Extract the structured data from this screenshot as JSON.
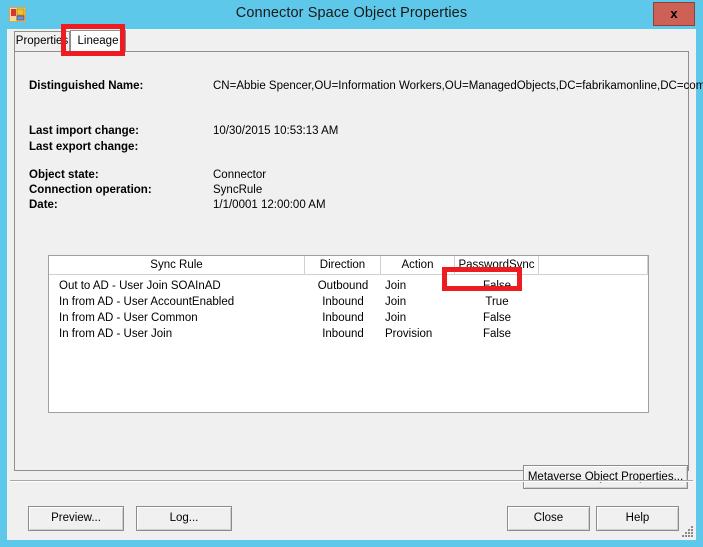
{
  "window": {
    "title": "Connector Space Object Properties",
    "app_icon": "properties-window-icon",
    "close_label": "x",
    "titlebar_color": "#5ec8ea",
    "close_button_color": "#cd6155"
  },
  "tabs": [
    {
      "label": "Properties",
      "selected": false
    },
    {
      "label": "Lineage",
      "selected": true
    }
  ],
  "details": {
    "distinguished_name_label": "Distinguished Name:",
    "distinguished_name_value": "CN=Abbie Spencer,OU=Information Workers,OU=ManagedObjects,DC=fabrikamonline,DC=com",
    "last_import_change_label": "Last import change:",
    "last_import_change_value": "10/30/2015 10:53:13 AM",
    "last_export_change_label": "Last export change:",
    "last_export_change_value": "",
    "object_state_label": "Object state:",
    "object_state_value": "Connector",
    "connection_operation_label": "Connection operation:",
    "connection_operation_value": "SyncRule",
    "date_label": "Date:",
    "date_value": "1/1/0001 12:00:00 AM"
  },
  "sync_rule_table": {
    "columns": [
      "Sync Rule",
      "Direction",
      "Action",
      "PasswordSync"
    ],
    "rows": [
      {
        "rule": "Out to AD - User Join SOAInAD",
        "direction": "Outbound",
        "action": "Join",
        "password_sync": "False"
      },
      {
        "rule": "In from AD - User AccountEnabled",
        "direction": "Inbound",
        "action": "Join",
        "password_sync": "True"
      },
      {
        "rule": "In from AD - User Common",
        "direction": "Inbound",
        "action": "Join",
        "password_sync": "False"
      },
      {
        "rule": "In from AD - User Join",
        "direction": "Inbound",
        "action": "Provision",
        "password_sync": "False"
      }
    ]
  },
  "buttons": {
    "metaverse_object_properties": "Metaverse Object Properties...",
    "preview": "Preview...",
    "log": "Log...",
    "close": "Close",
    "help": "Help"
  },
  "annotations": {
    "color": "#ee1c20",
    "targets": [
      "lineage-tab",
      "password-sync-true-cell"
    ]
  }
}
